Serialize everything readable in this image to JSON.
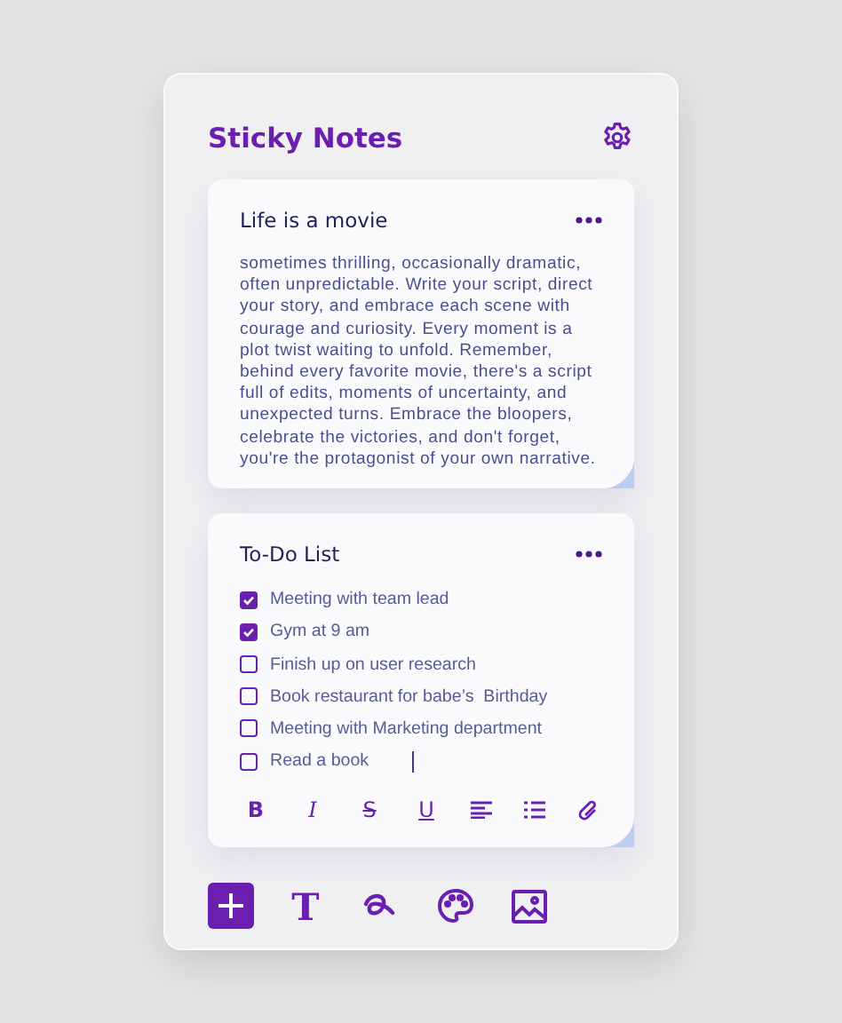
{
  "app": {
    "title": "Sticky Notes"
  },
  "notes": [
    {
      "kind": "text",
      "title": "Life is a movie",
      "body": "sometimes thrilling, occasionally dramatic, often unpredictable. Write your script, direct your story, and embrace each scene with courage and curiosity. Every moment is a plot twist waiting to unfold. Remember, behind every favorite movie, there's a script full of edits, moments of uncertainty, and unexpected turns. Embrace the bloopers, celebrate the victories, and don't forget, you're the protagonist of your own narrative."
    },
    {
      "kind": "todo",
      "title": "To-Do List",
      "items": [
        {
          "label": "Meeting with team lead",
          "checked": true
        },
        {
          "label": "Gym at 9 am",
          "checked": true
        },
        {
          "label": "Finish up on user research",
          "checked": false
        },
        {
          "label": "Book restaurant for babe’s  Birthday",
          "checked": false
        },
        {
          "label": "Meeting with Marketing department",
          "checked": false
        },
        {
          "label": "Read a book",
          "checked": false,
          "editing": true
        }
      ],
      "format_tools": [
        {
          "kind": "bold",
          "label": "B"
        },
        {
          "kind": "italic",
          "label": "I"
        },
        {
          "kind": "strike",
          "label": "S"
        },
        {
          "kind": "underline",
          "label": "U"
        },
        {
          "kind": "align"
        },
        {
          "kind": "list"
        },
        {
          "kind": "attach"
        }
      ]
    }
  ],
  "tools": [
    {
      "kind": "add",
      "selected": true
    },
    {
      "kind": "text",
      "label": "T",
      "selected": false
    },
    {
      "kind": "draw",
      "selected": false
    },
    {
      "kind": "palette",
      "selected": false
    },
    {
      "kind": "image",
      "selected": false
    }
  ]
}
